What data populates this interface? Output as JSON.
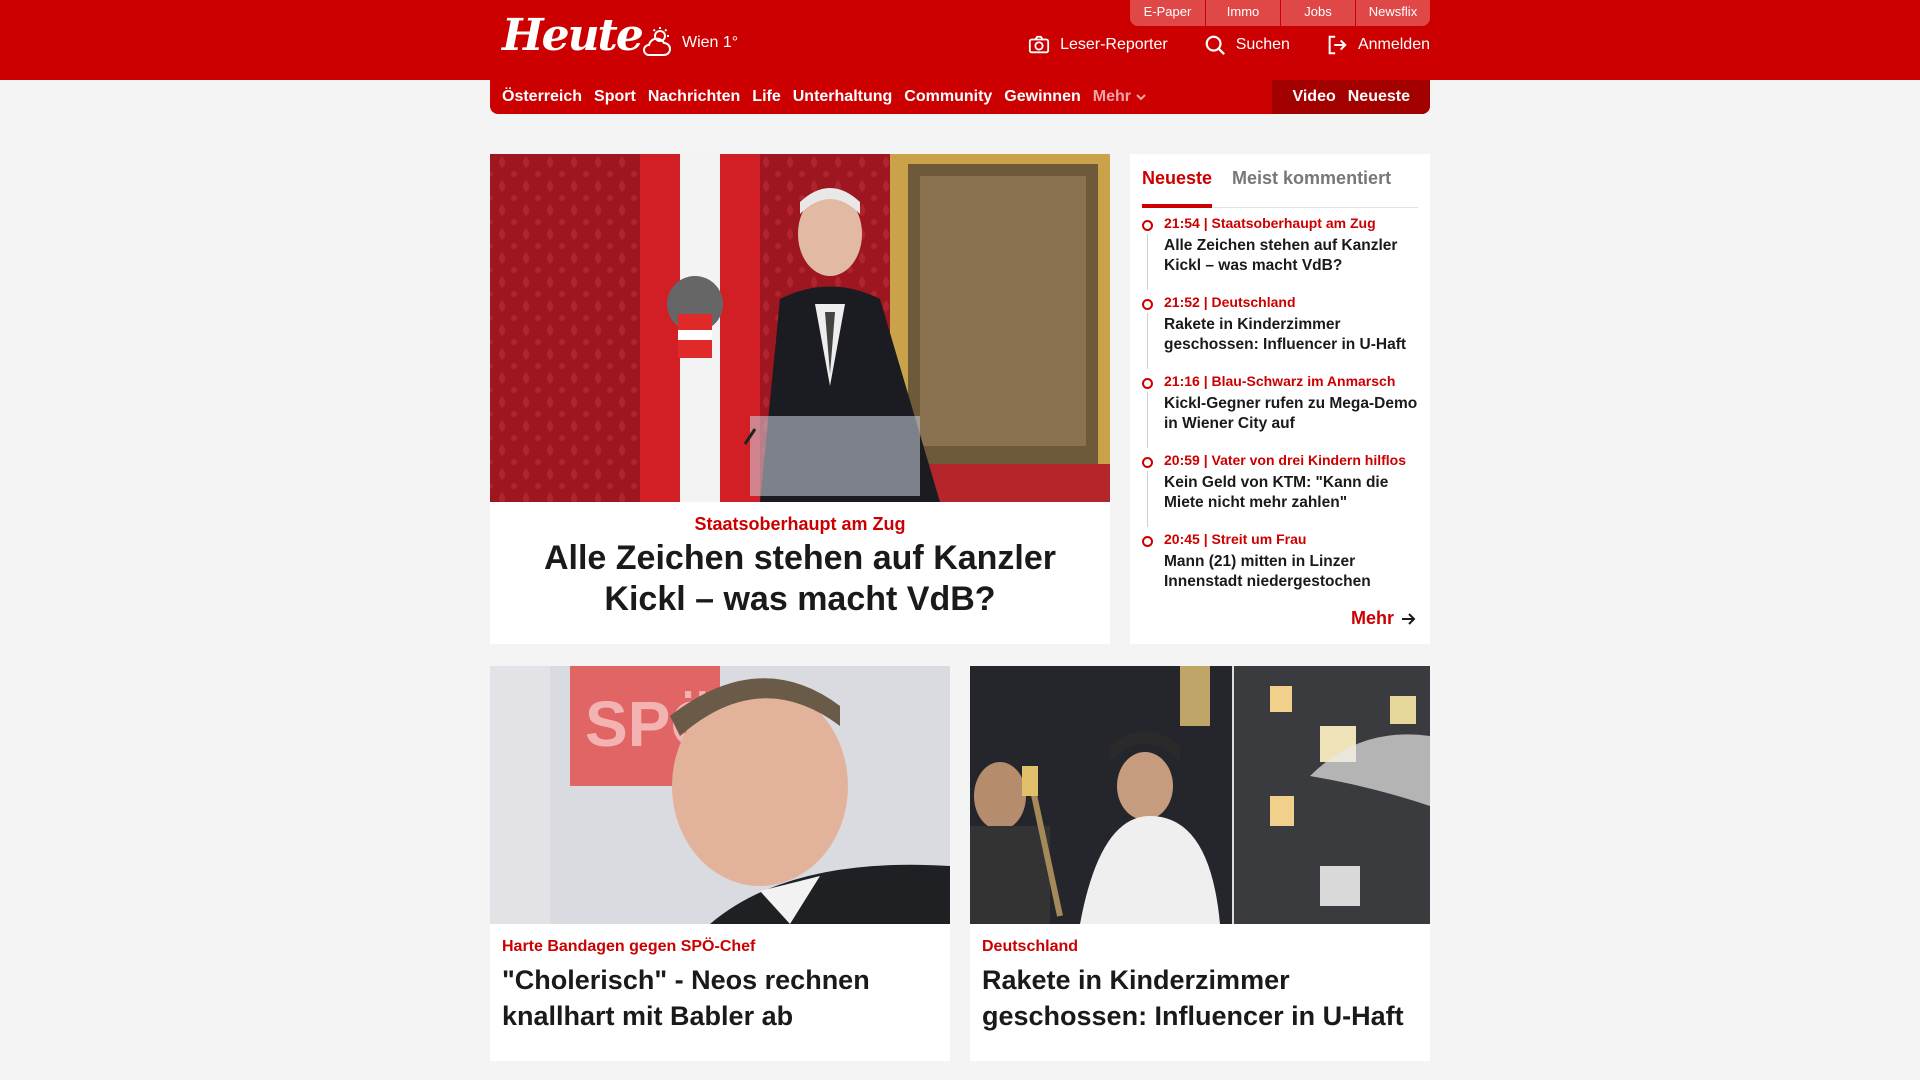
{
  "header": {
    "logo": "Heute",
    "weather": {
      "icon": "weather-cloud-sun-icon",
      "text": "Wien 1°"
    },
    "service_links": [
      "E-Paper",
      "Immo",
      "Jobs",
      "Newsflix"
    ],
    "actions": [
      {
        "label": "Leser-Reporter",
        "icon": "camera-icon"
      },
      {
        "label": "Suchen",
        "icon": "search-icon"
      },
      {
        "label": "Anmelden",
        "icon": "login-icon"
      }
    ]
  },
  "nav": {
    "items": [
      "Österreich",
      "Sport",
      "Nachrichten",
      "Life",
      "Unterhaltung",
      "Community",
      "Gewinnen"
    ],
    "more": "Mehr",
    "right": [
      "Video",
      "Neueste"
    ]
  },
  "hero": {
    "kicker": "Staatsoberhaupt am Zug",
    "title": "Alle Zeichen stehen auf Kanzler Kickl – was macht VdB?"
  },
  "sidebar": {
    "tabs": [
      "Neueste",
      "Meist kommentiert"
    ],
    "items": [
      {
        "meta": "21:54 | Staatsoberhaupt am Zug",
        "title": "Alle Zeichen stehen auf Kanzler Kickl – was macht VdB?"
      },
      {
        "meta": "21:52 | Deutschland",
        "title": "Rakete in Kinderzimmer geschossen: Influencer in U-Haft"
      },
      {
        "meta": "21:16 | Blau-Schwarz im Anmarsch",
        "title": "Kickl-Gegner rufen zu Mega-Demo in Wiener City auf"
      },
      {
        "meta": "20:59 | Vater von drei Kindern hilflos",
        "title": "Kein Geld von KTM: \"Kann die Miete nicht mehr zahlen\""
      },
      {
        "meta": "20:45 | Streit um Frau",
        "title": "Mann (21) mitten in Linzer Innenstadt niedergestochen"
      }
    ],
    "more": "Mehr"
  },
  "cards": [
    {
      "kicker": "Harte Bandagen gegen SPÖ-Chef",
      "title": "\"Cholerisch\" - Neos rechnen knallhart mit Babler ab",
      "image_text": "SPÖ"
    },
    {
      "kicker": "Deutschland",
      "title": "Rakete in Kinderzimmer geschossen: Influencer in U-Haft"
    }
  ],
  "colors": {
    "brand": "#cc0000",
    "brand_dark": "#a30000",
    "background": "#f4f4f4"
  }
}
